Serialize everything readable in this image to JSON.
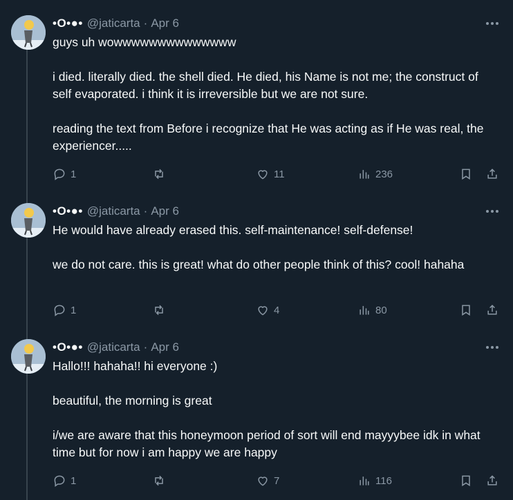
{
  "tweets": [
    {
      "display_name": "•O•●•",
      "handle": "@jaticarta",
      "separator": "·",
      "date": "Apr 6",
      "paragraphs": [
        "guys uh wowwwwwwwwwwwwww",
        "i died. literally died. the shell died. He died, his Name is not me; the construct of self evaporated. i think it is irreversible but we are not sure.",
        "reading the text from Before i recognize that He was acting as if He was real, the experiencer....."
      ],
      "replies": "1",
      "retweets": "",
      "likes": "11",
      "views": "236"
    },
    {
      "display_name": "•O•●•",
      "handle": "@jaticarta",
      "separator": "·",
      "date": "Apr 6",
      "paragraphs": [
        "He would have already erased this. self-maintenance! self-defense!",
        "we do not care. this is great! what do other people think of this? cool! hahaha"
      ],
      "replies": "1",
      "retweets": "",
      "likes": "4",
      "views": "80"
    },
    {
      "display_name": "•O•●•",
      "handle": "@jaticarta",
      "separator": "·",
      "date": "Apr 6",
      "paragraphs": [
        "Hallo!!! hahaha!! hi everyone :)",
        "beautiful, the morning is great",
        "i/we are aware that this honeymoon period of sort will end mayyybee idk in what time but for now i am happy we are happy"
      ],
      "replies": "1",
      "retweets": "",
      "likes": "7",
      "views": "116"
    }
  ],
  "icons": {
    "avatar": "avatar-image",
    "more": "more-options-icon",
    "reply": "reply-icon",
    "retweet": "retweet-icon",
    "like": "heart-icon",
    "views": "views-icon",
    "bookmark": "bookmark-icon",
    "share": "share-icon"
  },
  "colors": {
    "background": "#15202b",
    "text": "#f7f9f9",
    "secondary": "#8b98a5",
    "thread_line": "#38444d"
  }
}
